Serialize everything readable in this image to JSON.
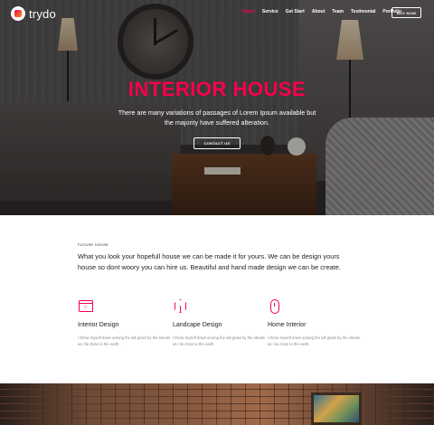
{
  "brand": {
    "name": "trydo"
  },
  "nav": {
    "items": [
      {
        "label": "Home",
        "active": true
      },
      {
        "label": "Service",
        "active": false
      },
      {
        "label": "Get Start",
        "active": false
      },
      {
        "label": "About",
        "active": false
      },
      {
        "label": "Team",
        "active": false
      },
      {
        "label": "Testimonial",
        "active": false
      },
      {
        "label": "Portfolio",
        "active": false
      }
    ],
    "buy_label": "BUY NOW"
  },
  "hero": {
    "title": "INTERIOR HOUSE",
    "subtitle": "There are many variations of passages of Lorem Ipsum available but the majority have suffered alteration.",
    "cta_label": "CONTACT US"
  },
  "about": {
    "kicker": "FUTURE HOUSE",
    "text": "What you look your hopefull house we can be made it for yours. We can be design yours house so dont woory you can hire us. Beautiful and hand made design we can be create."
  },
  "services": [
    {
      "icon": "browser-star-icon",
      "title": "Interior Design",
      "desc": "I throw myself down among the tall grass by the stream as I lie close to the earth."
    },
    {
      "icon": "cube-icon",
      "title": "Landcape Design",
      "desc": "I throw myself down among the tall grass by the stream as I lie close to the earth."
    },
    {
      "icon": "mouse-icon",
      "title": "Home Interior",
      "desc": "I throw myself down among the tall grass by the stream as I lie close to the earth."
    }
  ],
  "colors": {
    "accent": "#f9004d",
    "heading": "#1f1f25",
    "body": "#8a8a8a"
  }
}
